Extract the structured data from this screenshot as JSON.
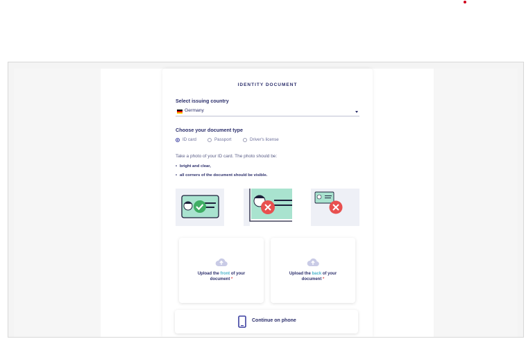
{
  "page": {
    "title": "IDENTITY DOCUMENT",
    "country_label": "Select issuing country",
    "country_value": "Germany",
    "doc_type_label": "Choose your document type",
    "doc_types": [
      {
        "label": "ID card",
        "checked": true
      },
      {
        "label": "Passport",
        "checked": false
      },
      {
        "label": "Driver's license",
        "checked": false
      }
    ],
    "instruction": "Take a photo of your ID card. The photo should be:",
    "bullets": [
      "bright and clear,",
      "all corners of the document should be visible."
    ],
    "upload_front": {
      "prefix": "Upload the ",
      "highlight": "front",
      "suffix": " of your",
      "line2": "document",
      "required": "*"
    },
    "upload_back": {
      "prefix": "Upload the ",
      "highlight": "back",
      "suffix": " of your",
      "line2": "document",
      "required": "*"
    },
    "continue_phone": "Continue on phone"
  },
  "colors": {
    "brand": "#2b2e6b",
    "accent": "#4ab3c9",
    "success": "#3fae64",
    "error": "#e8504f",
    "card_green": "#a9e3cf"
  },
  "icons": [
    "check-icon",
    "cross-icon",
    "cloud-upload-icon",
    "phone-icon",
    "chevron-down-icon"
  ]
}
